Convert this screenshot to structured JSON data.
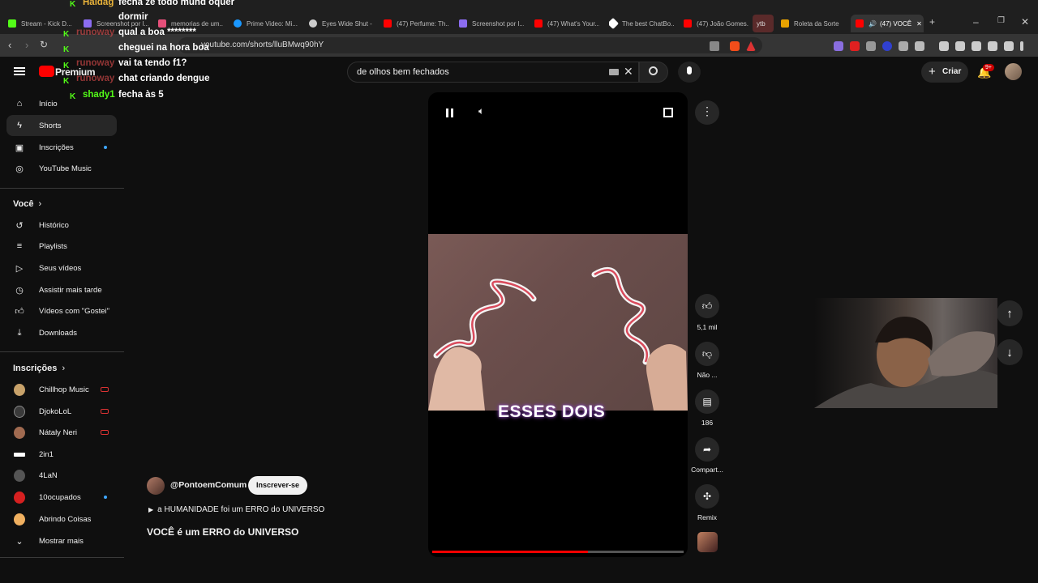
{
  "browser": {
    "tabs": [
      {
        "label": "Stream - Kick D...",
        "color": "#53fc18"
      },
      {
        "label": "Screenshot por l...",
        "color": "#8b6cf0"
      },
      {
        "label": "memorias de um...",
        "color": "#e54f7a"
      },
      {
        "label": "Prime Video: Mi...",
        "color": "#1a98ff"
      },
      {
        "label": "Eyes Wide Shut -",
        "color": "#cccccc"
      },
      {
        "label": "(47) Perfume: Th...",
        "color": "#ff0000"
      },
      {
        "label": "Screenshot por l...",
        "color": "#8b6cf0"
      },
      {
        "label": "(47) What's Your...",
        "color": "#ff0000"
      },
      {
        "label": "The best ChatBo...",
        "color": "#ffffff"
      },
      {
        "label": "(47) João Gomes...",
        "color": "#ff0000"
      },
      {
        "label": "ytb",
        "color": "#cc4444"
      },
      {
        "label": "Roleta da Sorte",
        "color": "#e8a200"
      },
      {
        "label": "(47) VOCÊ",
        "color": "#ff0000"
      }
    ],
    "url": "youtube.com/shorts/lluBMwq90hY"
  },
  "youtube": {
    "logo_text": "Premium",
    "search_value": "de olhos bem fechados",
    "create_label": "Criar",
    "notif_count": "9+"
  },
  "sidebar": {
    "main": [
      {
        "label": "Início",
        "icon": "home-icon"
      },
      {
        "label": "Shorts",
        "icon": "shorts-icon"
      },
      {
        "label": "Inscrições",
        "icon": "subscriptions-icon"
      },
      {
        "label": "YouTube Music",
        "icon": "music-icon"
      }
    ],
    "you_header": "Você",
    "you": [
      {
        "label": "Histórico",
        "icon": "history-icon"
      },
      {
        "label": "Playlists",
        "icon": "playlist-icon"
      },
      {
        "label": "Seus vídeos",
        "icon": "video-icon"
      },
      {
        "label": "Assistir mais tarde",
        "icon": "clock-icon"
      },
      {
        "label": "Vídeos com \"Gostei\"",
        "icon": "like-icon"
      },
      {
        "label": "Downloads",
        "icon": "download-icon"
      }
    ],
    "subs_header": "Inscrições",
    "subs": [
      {
        "label": "Chillhop Music",
        "color": "#c8a26a"
      },
      {
        "label": "DjokoLoL",
        "color": "#3a3a3a"
      },
      {
        "label": "Nátaly Neri",
        "color": "#a06a50"
      },
      {
        "label": "2in1",
        "color": "#ffffff"
      },
      {
        "label": "4LaN",
        "color": "#555555"
      },
      {
        "label": "10ocupados",
        "color": "#d62020"
      },
      {
        "label": "Abrindo Coisas",
        "color": "#f0b060"
      }
    ],
    "show_more": "Mostrar mais"
  },
  "chat": [
    {
      "user": "Haldag",
      "msg": "fecha ze todo mund oquer",
      "color": "#e8b23a"
    },
    {
      "user": "",
      "msg": "dormir",
      "color": "#e8b23a"
    },
    {
      "user": "runoway",
      "msg": "qual a boa ********",
      "color": "#d84a4a"
    },
    {
      "user": "",
      "msg": "cheguei na hora boa",
      "color": "#d84a4a"
    },
    {
      "user": "runoway",
      "msg": "vai ta tendo f1?",
      "color": "#d84a4a"
    },
    {
      "user": "runoway",
      "msg": "chat criando dengue",
      "color": "#d84a4a"
    },
    {
      "user": "shady1",
      "msg": "fecha às 5",
      "color": "#53fc18"
    }
  ],
  "short": {
    "caption": "ESSES DOIS",
    "channel": "@PontoemComum",
    "subscribe_label": "Inscrever-se",
    "description": "a HUMANIDADE foi um ERRO do UNIVERSO",
    "title": "VOCÊ é um ERRO do UNIVERSO",
    "progress": 0.62,
    "actions": {
      "likes": "5,1 mil",
      "dislike": "Não ...",
      "comments": "186",
      "share": "Compart...",
      "remix": "Remix"
    }
  }
}
